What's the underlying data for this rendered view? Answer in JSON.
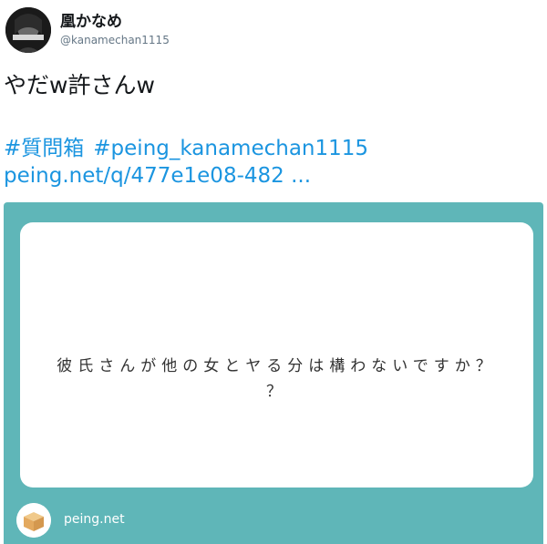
{
  "user": {
    "display_name": "凰かなめ",
    "handle": "@kanamechan1115"
  },
  "tweet": {
    "text": "やだw許さんw",
    "hashtags": [
      "#質問箱",
      "#peing_kanamechan1115"
    ],
    "link": "peing.net/q/477e1e08-482 ..."
  },
  "card": {
    "question_line1": "彼氏さんが他の女とヤる分は構わないですか？",
    "question_line2": "？",
    "source": "peing.net",
    "background_color": "#5fb6b8"
  }
}
